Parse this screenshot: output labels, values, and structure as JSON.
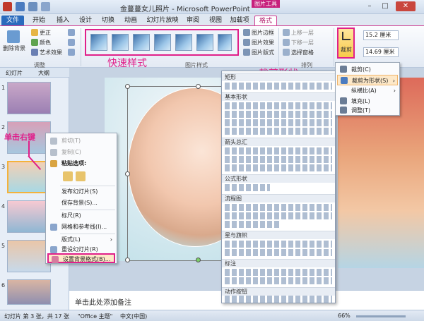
{
  "window": {
    "title": "金蔓蔓女儿照片 - Microsoft PowerPoint",
    "context_group": "图片工具"
  },
  "tabs": [
    "文件",
    "开始",
    "插入",
    "设计",
    "切换",
    "动画",
    "幻灯片放映",
    "审阅",
    "视图",
    "加载项",
    "格式"
  ],
  "ribbon": {
    "adjust": {
      "remove_bg": "删除背景",
      "corrections": "更正",
      "color": "颜色",
      "artistic": "艺术效果",
      "label": "调整"
    },
    "picture_styles": {
      "label": "图片样式",
      "border": "图片边框",
      "effects": "图片效果",
      "layout": "图片版式",
      "annotation": "快速样式"
    },
    "arrange": {
      "bring_forward": "上移一层",
      "send_backward": "下移一层",
      "selection_pane": "选择窗格",
      "label": "排列"
    },
    "size": {
      "crop": "裁剪",
      "height": "15.2 厘米",
      "width": "14.69 厘米"
    }
  },
  "panel": {
    "tab_slides": "幻灯片",
    "tab_outline": "大纲",
    "slide_numbers": [
      "1",
      "2",
      "3",
      "4",
      "5",
      "6"
    ],
    "annotation": "单击右键"
  },
  "context_menu": {
    "items": [
      "剪切(T)",
      "复制(C)",
      "粘贴选项:",
      "发布幻灯片(S)",
      "保存背景(S)...",
      "标尺(R)",
      "网格和参考线(I)...",
      "版式(L)",
      "重设幻灯片(R)",
      "设置背景格式(B)..."
    ]
  },
  "shape_gallery": {
    "annotation": "裁剪形状",
    "sections": [
      "矩形",
      "基本形状",
      "箭头总汇",
      "公式形状",
      "流程图",
      "星与旗帜",
      "标注",
      "动作按钮"
    ]
  },
  "crop_menu": {
    "items": [
      "裁剪(C)",
      "裁剪为形状(S)",
      "纵横比(A)",
      "填充(L)",
      "调整(T)"
    ]
  },
  "notes": {
    "placeholder": "单击此处添加备注"
  },
  "status": {
    "slide": "幻灯片 第 3 张，共 17 张",
    "theme": "\"Office 主题\"",
    "lang": "中文(中国)",
    "zoom": "66%"
  }
}
